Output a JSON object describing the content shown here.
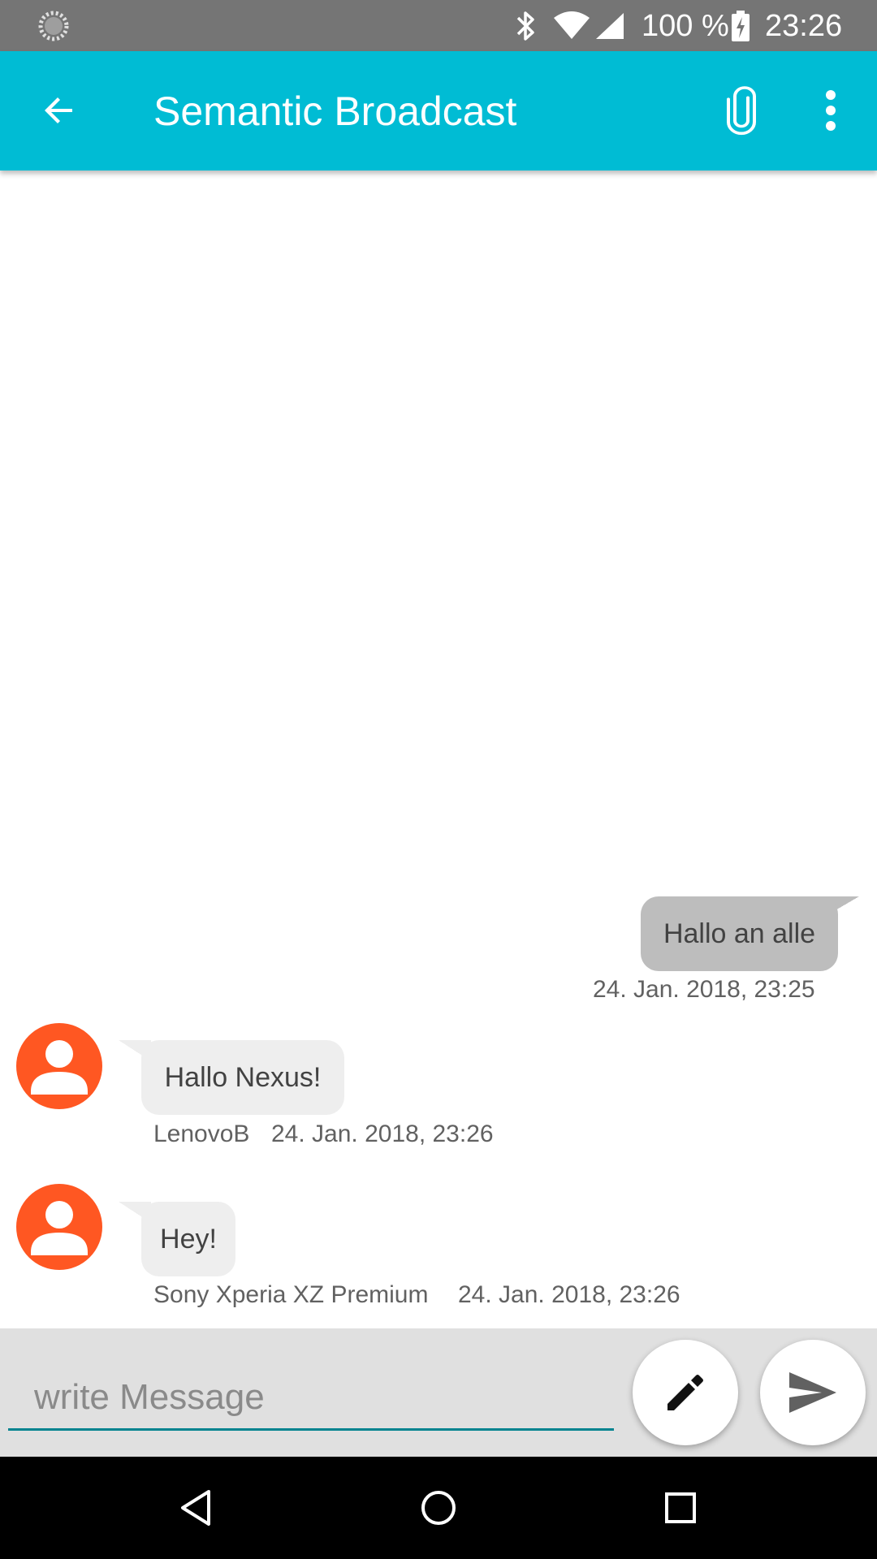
{
  "status_bar": {
    "battery_percent": "100 %",
    "time": "23:26"
  },
  "app_bar": {
    "title": "Semantic Broadcast",
    "accent_color": "#00bcd4"
  },
  "messages": [
    {
      "direction": "outgoing",
      "text": "Hallo an alle",
      "timestamp": "24. Jan. 2018, 23:25"
    },
    {
      "direction": "incoming",
      "sender": "LenovoB",
      "text": "Hallo Nexus!",
      "timestamp": "24. Jan. 2018, 23:26"
    },
    {
      "direction": "incoming",
      "sender": "Sony Xperia XZ Premium",
      "text": "Hey!",
      "timestamp": "24. Jan. 2018, 23:26"
    }
  ],
  "composer": {
    "placeholder": "write Message"
  },
  "icons": {
    "back": "arrow-left-icon",
    "attach": "paperclip-icon",
    "overflow": "more-vertical-icon",
    "edit": "pencil-icon",
    "send": "send-icon",
    "avatar": "person-icon"
  }
}
